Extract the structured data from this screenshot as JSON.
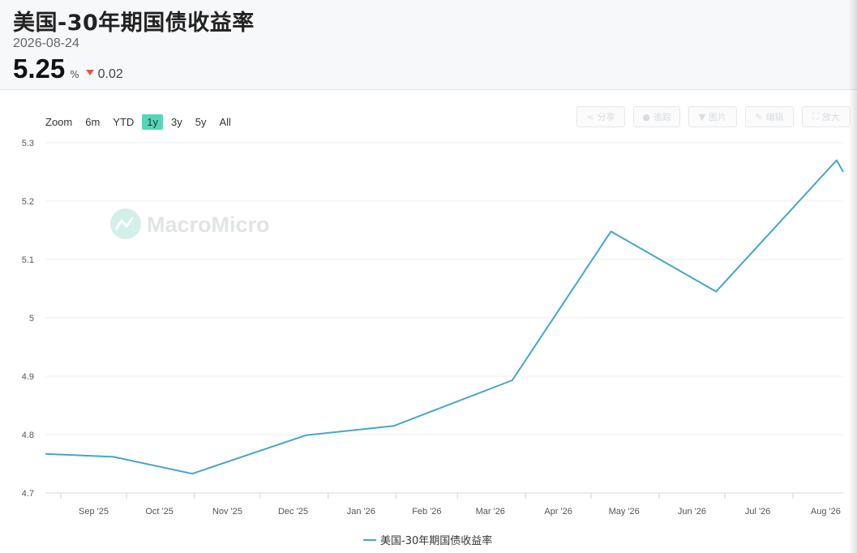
{
  "header": {
    "title": "美国-30年期国债收益率",
    "date": "2026-08-24",
    "value": "5.25",
    "unit": "%",
    "change": "0.02",
    "change_direction": "down",
    "change_color": "#e05545"
  },
  "zoom": {
    "label": "Zoom",
    "options": [
      "6m",
      "YTD",
      "1y",
      "3y",
      "5y",
      "All"
    ],
    "active": "1y",
    "active_color": "#55d6b8"
  },
  "toolbar": {
    "items": [
      {
        "icon": "share-icon",
        "label": "分享"
      },
      {
        "icon": "subscribe-icon",
        "label": "追踪"
      },
      {
        "icon": "download-icon",
        "label": "图片"
      },
      {
        "icon": "pencil-icon",
        "label": "编辑"
      },
      {
        "icon": "expand-icon",
        "label": "放大"
      }
    ]
  },
  "watermark": "MacroMicro",
  "chart_data": {
    "type": "line",
    "x_tick_labels": [
      "Sep '25",
      "Oct '25",
      "Nov '25",
      "Dec '25",
      "Jan '26",
      "Feb '26",
      "Mar '26",
      "Apr '26",
      "May '26",
      "Jun '26",
      "Jul '26",
      "Aug '26"
    ],
    "y_tick_labels": [
      "4.7",
      "4.8",
      "4.9",
      "5",
      "5.1",
      "5.2",
      "5.3"
    ],
    "ylim": [
      4.7,
      5.3
    ],
    "xlim": [
      "2025-08-25",
      "2026-08-24"
    ],
    "grid": true,
    "legend_position": "bottom-center",
    "series": [
      {
        "name": "美国-30年期国债收益率",
        "color": "#44a6c9",
        "x": [
          "2025-08-25",
          "2025-09-25",
          "2025-10-31",
          "2025-12-22",
          "2026-01-31",
          "2026-03-26",
          "2026-05-10",
          "2026-06-27",
          "2026-08-21",
          "2026-08-24"
        ],
        "y": [
          4.767,
          4.762,
          4.733,
          4.799,
          4.815,
          4.893,
          5.148,
          5.045,
          5.27,
          5.25
        ]
      }
    ]
  }
}
